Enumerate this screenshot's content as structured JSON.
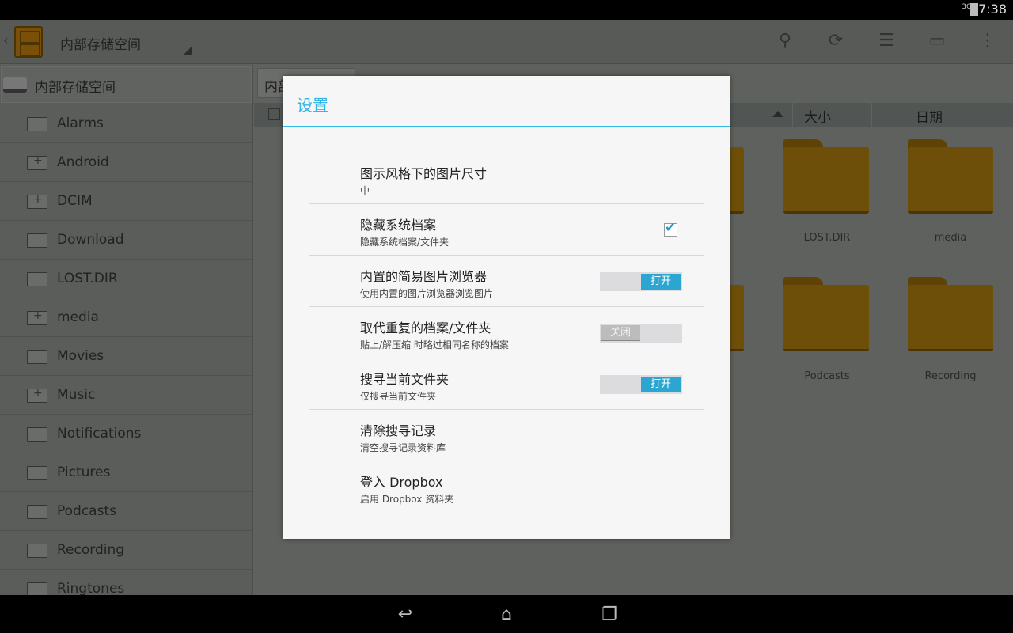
{
  "status": {
    "network": "3G",
    "time": "7:38"
  },
  "actionbar": {
    "title": "内部存储空间",
    "icons": [
      "search-icon",
      "refresh-icon",
      "list-view-icon",
      "new-folder-icon",
      "overflow-menu-icon"
    ]
  },
  "sidebar": {
    "header": "内部存储空间",
    "items": [
      {
        "label": "Alarms",
        "has_sub": false
      },
      {
        "label": "Android",
        "has_sub": true
      },
      {
        "label": "DCIM",
        "has_sub": true
      },
      {
        "label": "Download",
        "has_sub": false
      },
      {
        "label": "LOST.DIR",
        "has_sub": false
      },
      {
        "label": "media",
        "has_sub": true
      },
      {
        "label": "Movies",
        "has_sub": false
      },
      {
        "label": "Music",
        "has_sub": true
      },
      {
        "label": "Notifications",
        "has_sub": false
      },
      {
        "label": "Pictures",
        "has_sub": false
      },
      {
        "label": "Podcasts",
        "has_sub": false
      },
      {
        "label": "Recording",
        "has_sub": false
      },
      {
        "label": "Ringtones",
        "has_sub": false
      }
    ]
  },
  "main": {
    "breadcrumb": "内部",
    "columns": {
      "size": "大小",
      "date": "日期"
    },
    "grid": [
      "LOST.DIR",
      "media",
      "Podcasts",
      "Recording"
    ]
  },
  "dialog": {
    "title": "设置",
    "prefs": [
      {
        "title": "图示风格下的图片尺寸",
        "summary": "中",
        "control": "none"
      },
      {
        "title": "隐藏系统档案",
        "summary": "隐藏系统档案/文件夹",
        "control": "checkbox",
        "checked": true
      },
      {
        "title": "内置的简易图片浏览器",
        "summary": "使用内置的图片浏览器浏览图片",
        "control": "toggle",
        "state": "打开"
      },
      {
        "title": "取代重复的档案/文件夹",
        "summary": "贴上/解压缩 时略过相同名称的档案",
        "control": "toggle",
        "state": "关闭"
      },
      {
        "title": "搜寻当前文件夹",
        "summary": "仅搜寻当前文件夹",
        "control": "toggle",
        "state": "打开"
      },
      {
        "title": "清除搜寻记录",
        "summary": "清空搜寻记录资料库",
        "control": "none"
      },
      {
        "title": "登入 Dropbox",
        "summary": "启用 Dropbox 资料夹",
        "control": "none"
      }
    ]
  },
  "colors": {
    "accent": "#33b5e5",
    "toggle_on": "#2aa6d0",
    "folder": "#c8961e"
  }
}
